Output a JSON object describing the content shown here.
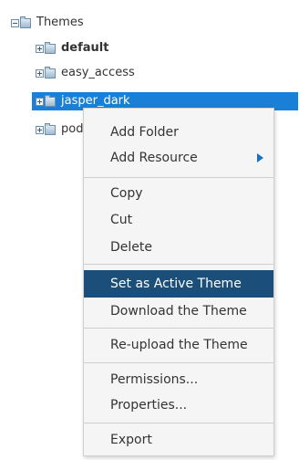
{
  "tree": {
    "root": {
      "label": "Themes",
      "icon": "folder-open-icon"
    },
    "children": [
      {
        "label": "default",
        "icon": "folder-collapsed-icon",
        "bold": true
      },
      {
        "label": "easy_access",
        "icon": "folder-collapsed-icon"
      },
      {
        "label": "jasper_dark",
        "icon": "folder-collapsed-icon",
        "selected": true
      },
      {
        "label": "pods",
        "icon": "folder-collapsed-icon"
      }
    ]
  },
  "context_menu": {
    "items": [
      {
        "label": "Add Folder"
      },
      {
        "label": "Add Resource",
        "submenu": true
      },
      {
        "label": "Copy"
      },
      {
        "label": "Cut"
      },
      {
        "label": "Delete"
      },
      {
        "label": "Set as Active Theme",
        "highlighted": true
      },
      {
        "label": "Download the Theme"
      },
      {
        "label": "Re-upload the Theme"
      },
      {
        "label": "Permissions..."
      },
      {
        "label": "Properties..."
      },
      {
        "label": "Export"
      }
    ]
  },
  "colors": {
    "selection": "#1a7fd6",
    "menu_highlight": "#1b4f7a",
    "submenu_arrow": "#1a6fc0"
  }
}
